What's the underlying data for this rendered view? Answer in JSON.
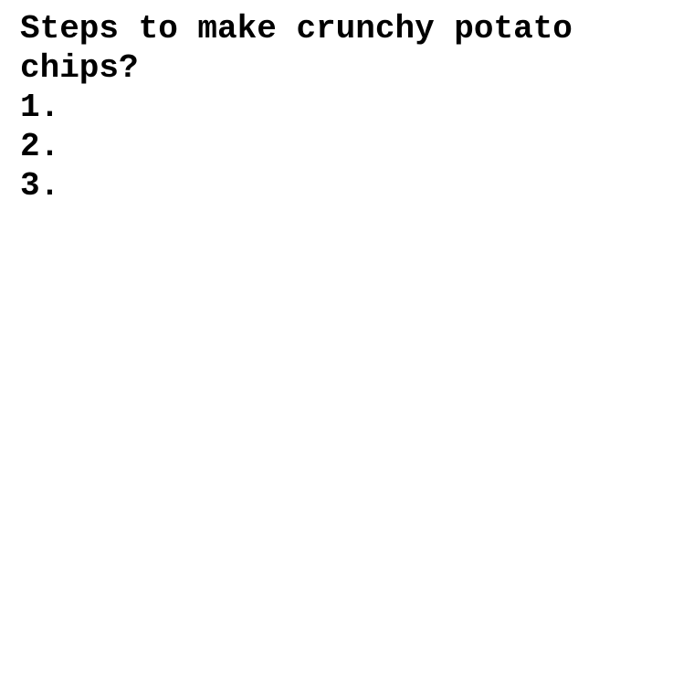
{
  "question": "Steps to make crunchy potato chips?",
  "steps": [
    {
      "label": "1."
    },
    {
      "label": "2."
    },
    {
      "label": "3."
    }
  ],
  "colors": {
    "background": "#ffffff",
    "text": "#000000"
  }
}
